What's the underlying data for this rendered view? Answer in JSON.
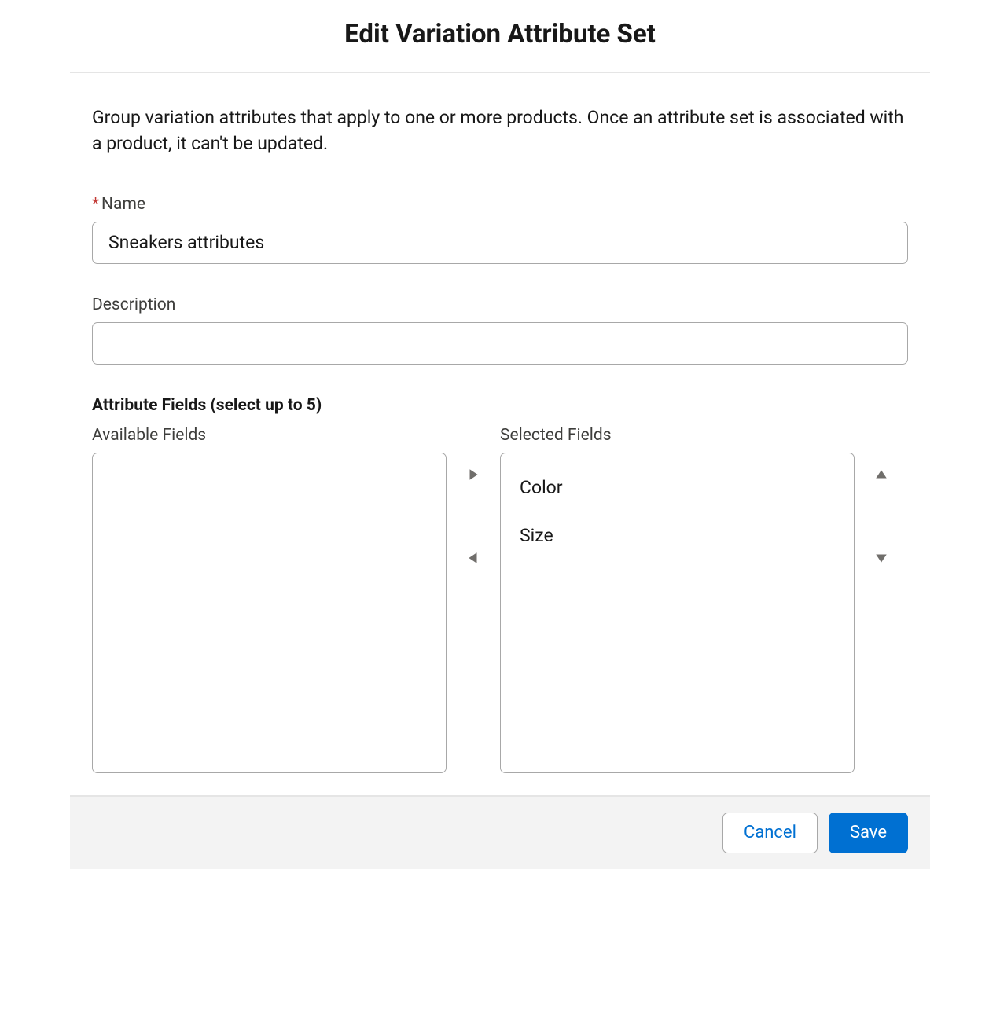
{
  "dialog": {
    "title": "Edit Variation Attribute Set",
    "intro": "Group variation attributes that apply to one or more products. Once an attribute set is associated with a product, it can't be updated."
  },
  "form": {
    "name_label": "Name",
    "name_value": "Sneakers attributes",
    "description_label": "Description",
    "description_value": ""
  },
  "attributes": {
    "section_heading": "Attribute Fields (select up to 5)",
    "available_label": "Available Fields",
    "available_fields": [],
    "selected_label": "Selected Fields",
    "selected_fields": [
      "Color",
      "Size"
    ]
  },
  "footer": {
    "cancel_label": "Cancel",
    "save_label": "Save"
  }
}
